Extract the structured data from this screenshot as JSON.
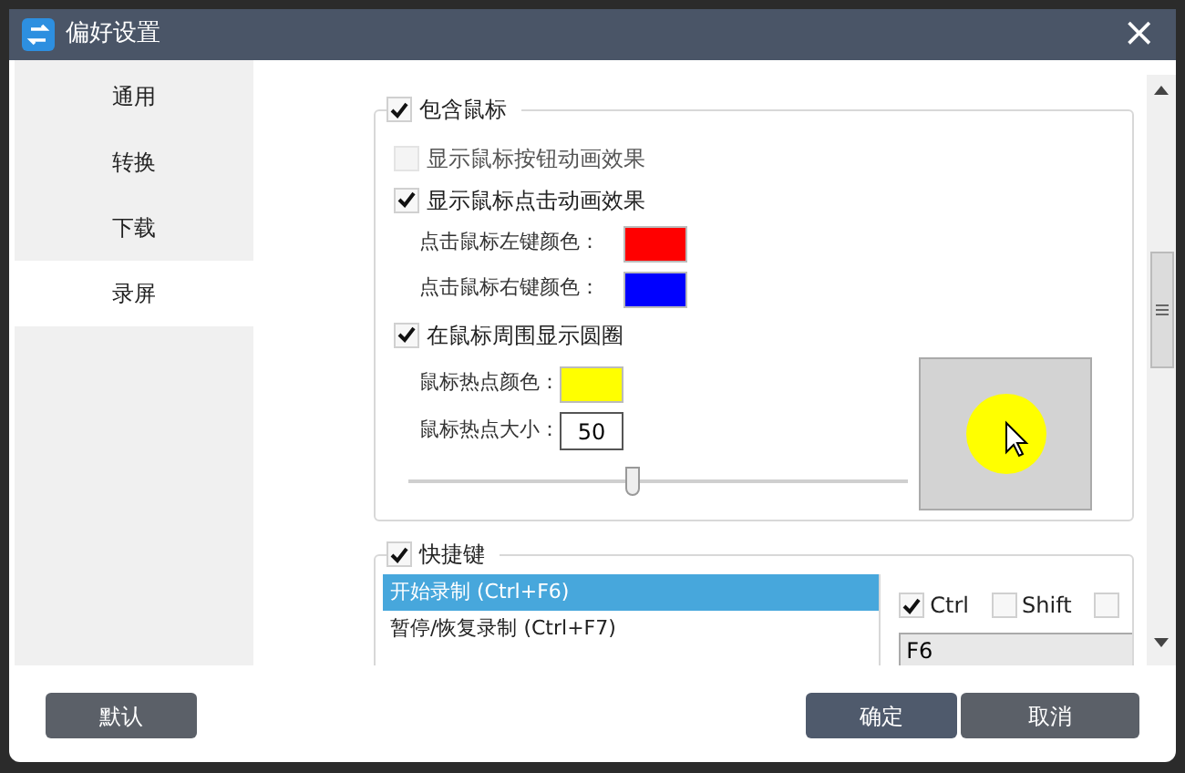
{
  "window": {
    "title": "偏好设置",
    "close": "×"
  },
  "sidebar": {
    "items": [
      {
        "label": "通用",
        "selected": false
      },
      {
        "label": "转换",
        "selected": false
      },
      {
        "label": "下载",
        "selected": false
      },
      {
        "label": "录屏",
        "selected": true
      }
    ]
  },
  "mouse_group": {
    "label": "包含鼠标",
    "checked": true,
    "options": [
      {
        "label": "显示鼠标按钮动画效果",
        "checked": false
      },
      {
        "label": "显示鼠标点击动画效果",
        "checked": true
      }
    ],
    "click_colors": [
      {
        "label": "点击鼠标左键颜色：",
        "color": "#ff0000"
      },
      {
        "label": "点击鼠标右键颜色：",
        "color": "#0000ff"
      }
    ],
    "circle": {
      "label": "在鼠标周围显示圆圈",
      "checked": true
    },
    "hotspot_color": {
      "label": "鼠标热点颜色：",
      "color": "#ffff00"
    },
    "hotspot_size": {
      "label": "鼠标热点大小：",
      "value": "50"
    },
    "size_slider": {
      "level": 0.45
    }
  },
  "hotkey_group": {
    "label": "快捷键",
    "checked": true,
    "actions": [
      {
        "label": "开始录制 (Ctrl+F6)",
        "selected": true
      },
      {
        "label": "暂停/恢复录制 (Ctrl+F7)",
        "selected": false
      }
    ],
    "modifiers": [
      {
        "label": "Ctrl",
        "checked": true
      },
      {
        "label": "Shift",
        "checked": false
      },
      {
        "checked": false
      }
    ],
    "key": {
      "value": "F6"
    }
  },
  "buttons": {
    "default": "默认",
    "ok": "确定",
    "cancel": "取消"
  }
}
